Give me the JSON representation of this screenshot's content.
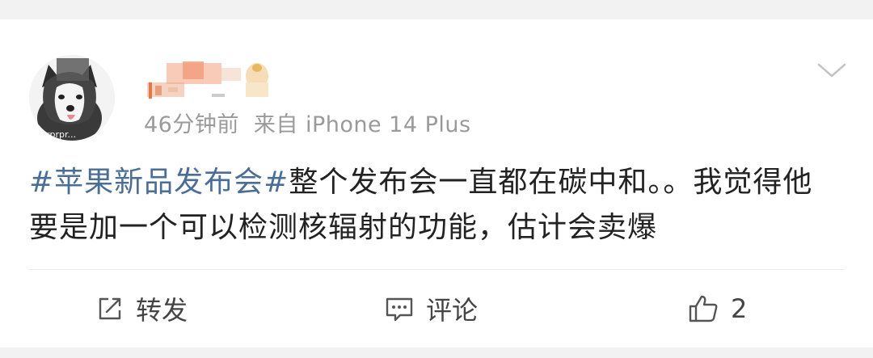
{
  "post": {
    "meta_time": "46分钟前",
    "meta_source": "来自 iPhone 14 Plus",
    "avatar_caption": "prprpr...",
    "hashtag": "#苹果新品发布会#",
    "body_text": "整个发布会一直都在碳中和。。我觉得他要是加一个可以检测核辐射的功能，估计会卖爆"
  },
  "actions": {
    "forward_label": "转发",
    "comment_label": "评论",
    "like_count": "2"
  },
  "icons": {
    "more": "chevron-down-icon",
    "forward": "share-edit-icon",
    "comment": "comment-icon",
    "like": "thumbs-up-icon"
  },
  "colors": {
    "hashtag": "#4b6e97",
    "meta": "#9a9a9a",
    "text": "#222222",
    "background": "#f2f2f2"
  }
}
